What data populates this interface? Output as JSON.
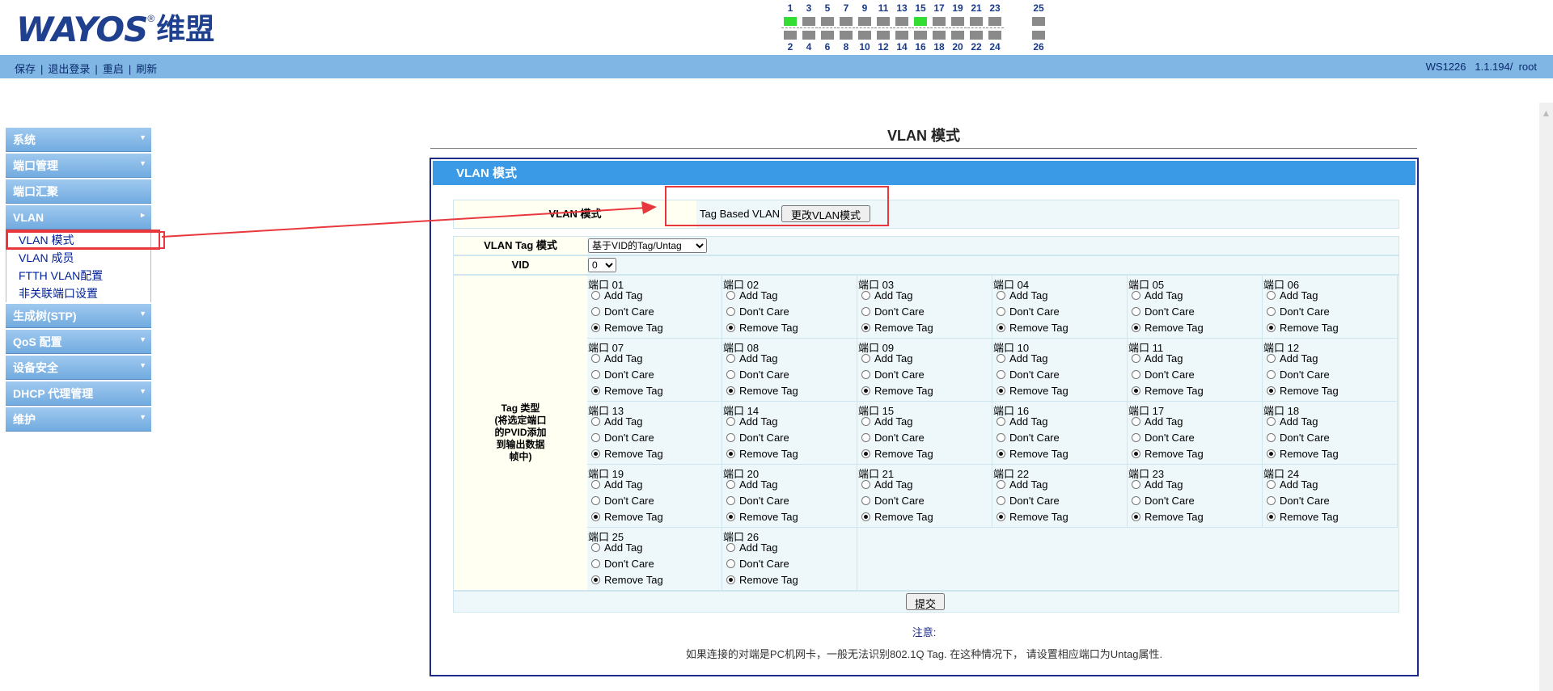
{
  "header": {
    "logo_text": "WAYOS",
    "logo_reg": "®",
    "logo_cn": "维盟",
    "ports": [
      {
        "top": "1",
        "bottom": "2",
        "top_on": true,
        "bottom_on": false
      },
      {
        "top": "3",
        "bottom": "4",
        "top_on": false,
        "bottom_on": false
      },
      {
        "top": "5",
        "bottom": "6",
        "top_on": false,
        "bottom_on": false
      },
      {
        "top": "7",
        "bottom": "8",
        "top_on": false,
        "bottom_on": false
      },
      {
        "top": "9",
        "bottom": "10",
        "top_on": false,
        "bottom_on": false
      },
      {
        "top": "11",
        "bottom": "12",
        "top_on": false,
        "bottom_on": false
      },
      {
        "top": "13",
        "bottom": "14",
        "top_on": false,
        "bottom_on": false
      },
      {
        "top": "15",
        "bottom": "16",
        "top_on": true,
        "bottom_on": false
      },
      {
        "top": "17",
        "bottom": "18",
        "top_on": false,
        "bottom_on": false
      },
      {
        "top": "19",
        "bottom": "20",
        "top_on": false,
        "bottom_on": false
      },
      {
        "top": "21",
        "bottom": "22",
        "top_on": false,
        "bottom_on": false
      },
      {
        "top": "23",
        "bottom": "24",
        "top_on": false,
        "bottom_on": false
      },
      {
        "top": "25",
        "bottom": "26",
        "top_on": false,
        "bottom_on": false
      }
    ]
  },
  "toolbar": {
    "links": [
      "保存",
      "退出登录",
      "重启",
      "刷新"
    ],
    "model": "WS1226",
    "version": "1.1.194",
    "sep": "/",
    "user": "root"
  },
  "menu": {
    "groups": [
      {
        "label": "系统",
        "arrow": "down"
      },
      {
        "label": "端口管理",
        "arrow": "down"
      },
      {
        "label": "端口汇聚",
        "arrow": "none"
      },
      {
        "label": "VLAN",
        "arrow": "right",
        "items": [
          "VLAN 模式",
          "VLAN 成员",
          "FTTH VLAN配置",
          "非关联端口设置"
        ],
        "selected": 0
      },
      {
        "label": "生成树(STP)",
        "arrow": "down"
      },
      {
        "label": "QoS 配置",
        "arrow": "down"
      },
      {
        "label": "设备安全",
        "arrow": "down"
      },
      {
        "label": "DHCP 代理管理",
        "arrow": "down"
      },
      {
        "label": "维护",
        "arrow": "down"
      }
    ]
  },
  "page": {
    "title": "VLAN 模式",
    "box_title": "VLAN 模式",
    "mode_label": "VLAN 模式",
    "mode_value": "Tag Based VLAN",
    "change_button": "更改VLAN模式",
    "tag_mode_label": "VLAN Tag 模式",
    "tag_mode_value": "基于VID的Tag/Untag",
    "vid_label": "VID",
    "vid_value": "0",
    "tag_type_label": "Tag 类型\n(将选定端口\n的PVID添加\n到输出数据\n帧中)",
    "port_prefix": "端口",
    "options": [
      "Add Tag",
      "Don't Care",
      "Remove Tag"
    ],
    "port_selection": [
      "Remove Tag",
      "Remove Tag",
      "Remove Tag",
      "Remove Tag",
      "Remove Tag",
      "Remove Tag",
      "Remove Tag",
      "Remove Tag",
      "Remove Tag",
      "Remove Tag",
      "Remove Tag",
      "Remove Tag",
      "Remove Tag",
      "Remove Tag",
      "Remove Tag",
      "Remove Tag",
      "Remove Tag",
      "Remove Tag",
      "Remove Tag",
      "Remove Tag",
      "Remove Tag",
      "Remove Tag",
      "Remove Tag",
      "Remove Tag",
      "Remove Tag",
      "Remove Tag"
    ],
    "submit_button": "提交",
    "note_title": "注意:",
    "note_text": "如果连接的对端是PC机网卡，一般无法识别802.1Q Tag. 在这种情况下，  请设置相应端口为Untag属性."
  },
  "colors": {
    "toolbar_bg": "#7fb6e3",
    "box_header": "#3a9ae6",
    "box_border": "#1c2a8c",
    "annotation": "#e8383d",
    "port_active": "#33dd33"
  }
}
